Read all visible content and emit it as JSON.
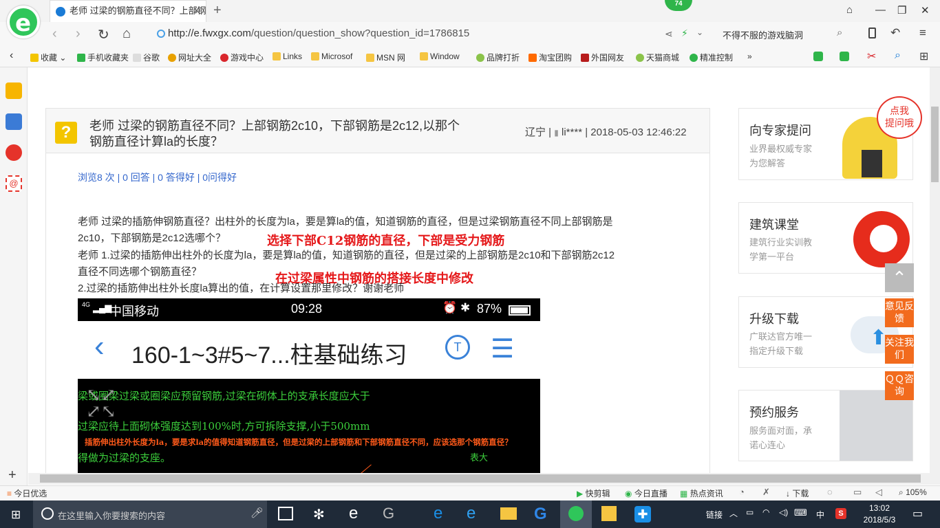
{
  "browser": {
    "tab_title": "老师 过梁的钢筋直径不同？上部钢",
    "badge": "74",
    "url_main": "http://e.fwxgx.com",
    "url_path": "/question/question_show?question_id=1786815",
    "search_text": "不得不服的游戏脑洞"
  },
  "bookmarks": [
    "收藏",
    "手机收藏夹",
    "谷歌",
    "网址大全",
    "游戏中心",
    "Links",
    "Microsof",
    "MSN 网",
    "Window",
    "品牌打折",
    "淘宝团购",
    "外国网友",
    "天猫商城",
    "精准控制"
  ],
  "question": {
    "title_line1": "老师 过梁的钢筋直径不同？上部钢筋2c10，下部钢筋是2c12,以那个",
    "title_line2": "钢筋直径计算la的长度？",
    "meta": "辽宁 | ",
    "user": "li****",
    "date": " | 2018-05-03 12:46:22",
    "stats": "浏览8 次 | 0 回答 | 0 答得好 | 0问得好",
    "p1": "老师 过梁的插筋伸钢筋直径？出柱外的长度为la，要是算la的值，知道钢筋的直径，但是过梁钢筋直径不同上部钢筋是",
    "p2": "2c10，下部钢筋是2c12选哪个？",
    "ann1": "选择下部C12钢筋的直径，下部是受力钢筋",
    "p3": "老师  1.过梁的插筋伸出柱外的长度为la，要是算la的值，知道钢筋的直径，但是过梁的上部钢筋是2c10和下部钢筋2c12",
    "p4": "直径不同选哪个钢筋直径？",
    "ann2": "在过梁属性中钢筋的搭接长度中修改",
    "p5": "2.过梁的插筋伸出柱外长度la算出的值，在计算设置那里修改？谢谢老师"
  },
  "phone": {
    "carrier": "中国移动",
    "signal": "4G",
    "time": "09:28",
    "battery": "87%",
    "title": "160-1~3#5~7...柱基础练习",
    "cad1": "梁或圈梁过梁或圈梁应预留钢筋,过梁在砌体上的支承长度应大于",
    "cad2": "过梁应待上面砌体强度达到100%时,方可拆除支撑,小于500mm",
    "cad3": "插筋伸出柱外长度为la，要是求la的值得知道钢筋直径，但是过梁的上部钢筋和下部钢筋直径不同，应该选那个钢筋直径？",
    "cad4": "得做为过梁的支座。",
    "cad5": "表大"
  },
  "sidebar": {
    "ask_title": "向专家提问",
    "ask_sub1": "业界最权威专家",
    "ask_sub2": "为您解答",
    "bubble": "点我\n提问哦",
    "course_title": "建筑课堂",
    "course_sub1": "建筑行业实训教",
    "course_sub2": "学第一平台",
    "upgrade_title": "升级下载",
    "upgrade_sub1": "广联达官方唯一",
    "upgrade_sub2": "指定升级下载",
    "service_title": "预约服务",
    "service_sub1": "服务面对面，承",
    "service_sub2": "诺心连心",
    "feedback": "意见反馈",
    "follow": "关注我们",
    "qq": "ＱＱ咨询"
  },
  "statusbar": {
    "left": "今日优选",
    "items": [
      "快剪辑",
      "今日直播",
      "热点资讯",
      "下载",
      "105%"
    ]
  },
  "taskbar": {
    "search_placeholder": "在这里输入你要搜索的内容",
    "link": "链接",
    "ime": "中",
    "time": "13:02",
    "date": "2018/5/3"
  }
}
